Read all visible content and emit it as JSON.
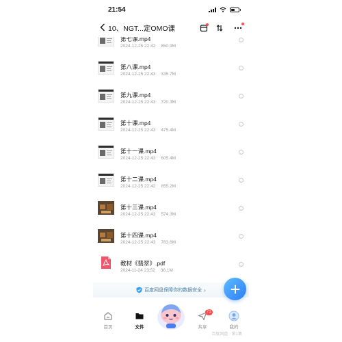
{
  "status_bar": {
    "time": "21:54"
  },
  "header": {
    "title": "10、NGT...定OMO课"
  },
  "files": [
    {
      "name": "第七课.mp4",
      "date": "2024-12-25 22:42",
      "size": "850.9M",
      "thumb": "doc"
    },
    {
      "name": "第八课.mp4",
      "date": "2024-12-25 22:43",
      "size": "335.7M",
      "thumb": "doc"
    },
    {
      "name": "第九课.mp4",
      "date": "2024-12-25 22:43",
      "size": "720.3M",
      "thumb": "doc"
    },
    {
      "name": "第十课.mp4",
      "date": "2024-12-25 22:43",
      "size": "475.4M",
      "thumb": "doc"
    },
    {
      "name": "第十一课.mp4",
      "date": "2024-12-25 22:43",
      "size": "605.4M",
      "thumb": "doc"
    },
    {
      "name": "第十二课.mp4",
      "date": "2024-12-25 22:42",
      "size": "855.2M",
      "thumb": "doc"
    },
    {
      "name": "第十三课.mp4",
      "date": "2024-12-25 22:43",
      "size": "574.3M",
      "thumb": "photo"
    },
    {
      "name": "第十四课.mp4",
      "date": "2024-12-25 22:43",
      "size": "783.6M",
      "thumb": "photo"
    },
    {
      "name": "教材《翡翠》.pdf",
      "date": "2024-11-24 23:52",
      "size": "36.1M",
      "thumb": "pdf"
    }
  ],
  "security_bar": {
    "text": "百度网盘保障你的数据安全"
  },
  "tab_bar": {
    "items": [
      {
        "label": "首页",
        "icon": "home-icon"
      },
      {
        "label": "文件",
        "icon": "folder-icon",
        "active": true
      },
      {
        "label": "共享",
        "icon": "share-icon",
        "badge": "71"
      },
      {
        "label": "我的",
        "icon": "profile-icon"
      }
    ],
    "watermark": "百度网盘 · 第1集"
  },
  "colors": {
    "accent": "#2f7df6",
    "badge": "#ff4d4f",
    "pdf": "#f0556a"
  }
}
